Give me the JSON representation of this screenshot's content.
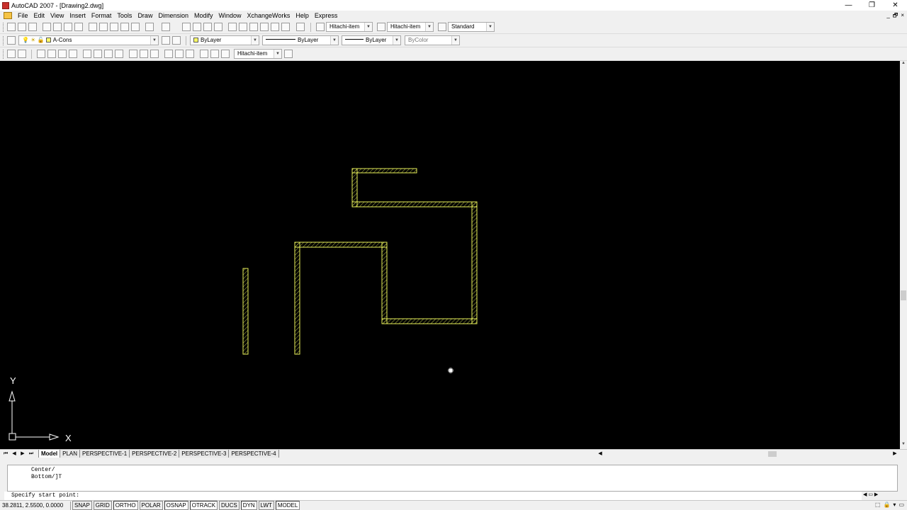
{
  "window": {
    "title": "AutoCAD 2007 - [Drawing2.dwg]",
    "controls": [
      "—",
      "❐",
      "✕"
    ]
  },
  "menu": {
    "items": [
      "File",
      "Edit",
      "View",
      "Insert",
      "Format",
      "Tools",
      "Draw",
      "Dimension",
      "Modify",
      "Window",
      "XchangeWorks",
      "Help",
      "Express"
    ],
    "child_controls": [
      "_",
      "🗗",
      "×"
    ]
  },
  "toolbar": {
    "text_style": "Hitachi-item",
    "dim_style": "Hitachi-item",
    "table_style": "Standard",
    "layer": "A-Cons",
    "color": "ByLayer",
    "linetype": "ByLayer",
    "lineweight": "ByLayer",
    "plot_style": "ByColor",
    "dim_style_2": "Hitachi-item"
  },
  "ucs": {
    "x_label": "X",
    "y_label": "Y"
  },
  "layout_tabs": [
    {
      "label": "Model",
      "active": true
    },
    {
      "label": "PLAN",
      "active": false
    },
    {
      "label": "PERSPECTIVE-1",
      "active": false
    },
    {
      "label": "PERSPECTIVE-2",
      "active": false
    },
    {
      "label": "PERSPECTIVE-3",
      "active": false
    },
    {
      "label": "PERSPECTIVE-4",
      "active": false
    }
  ],
  "command": {
    "history": [
      "Center/",
      "Bottom/]T"
    ],
    "prompt": "Specify start point:"
  },
  "status": {
    "coordinates": "38.2811, 2.5500, 0.0000",
    "toggles": [
      {
        "label": "SNAP",
        "on": false
      },
      {
        "label": "GRID",
        "on": false
      },
      {
        "label": "ORTHO",
        "on": true
      },
      {
        "label": "POLAR",
        "on": false
      },
      {
        "label": "OSNAP",
        "on": true
      },
      {
        "label": "OTRACK",
        "on": true
      },
      {
        "label": "DUCS",
        "on": false
      },
      {
        "label": "DYN",
        "on": true
      },
      {
        "label": "LWT",
        "on": false
      },
      {
        "label": "MODEL",
        "on": true
      }
    ]
  },
  "colors": {
    "wall": "#e8f05a",
    "canvas": "#000000"
  }
}
